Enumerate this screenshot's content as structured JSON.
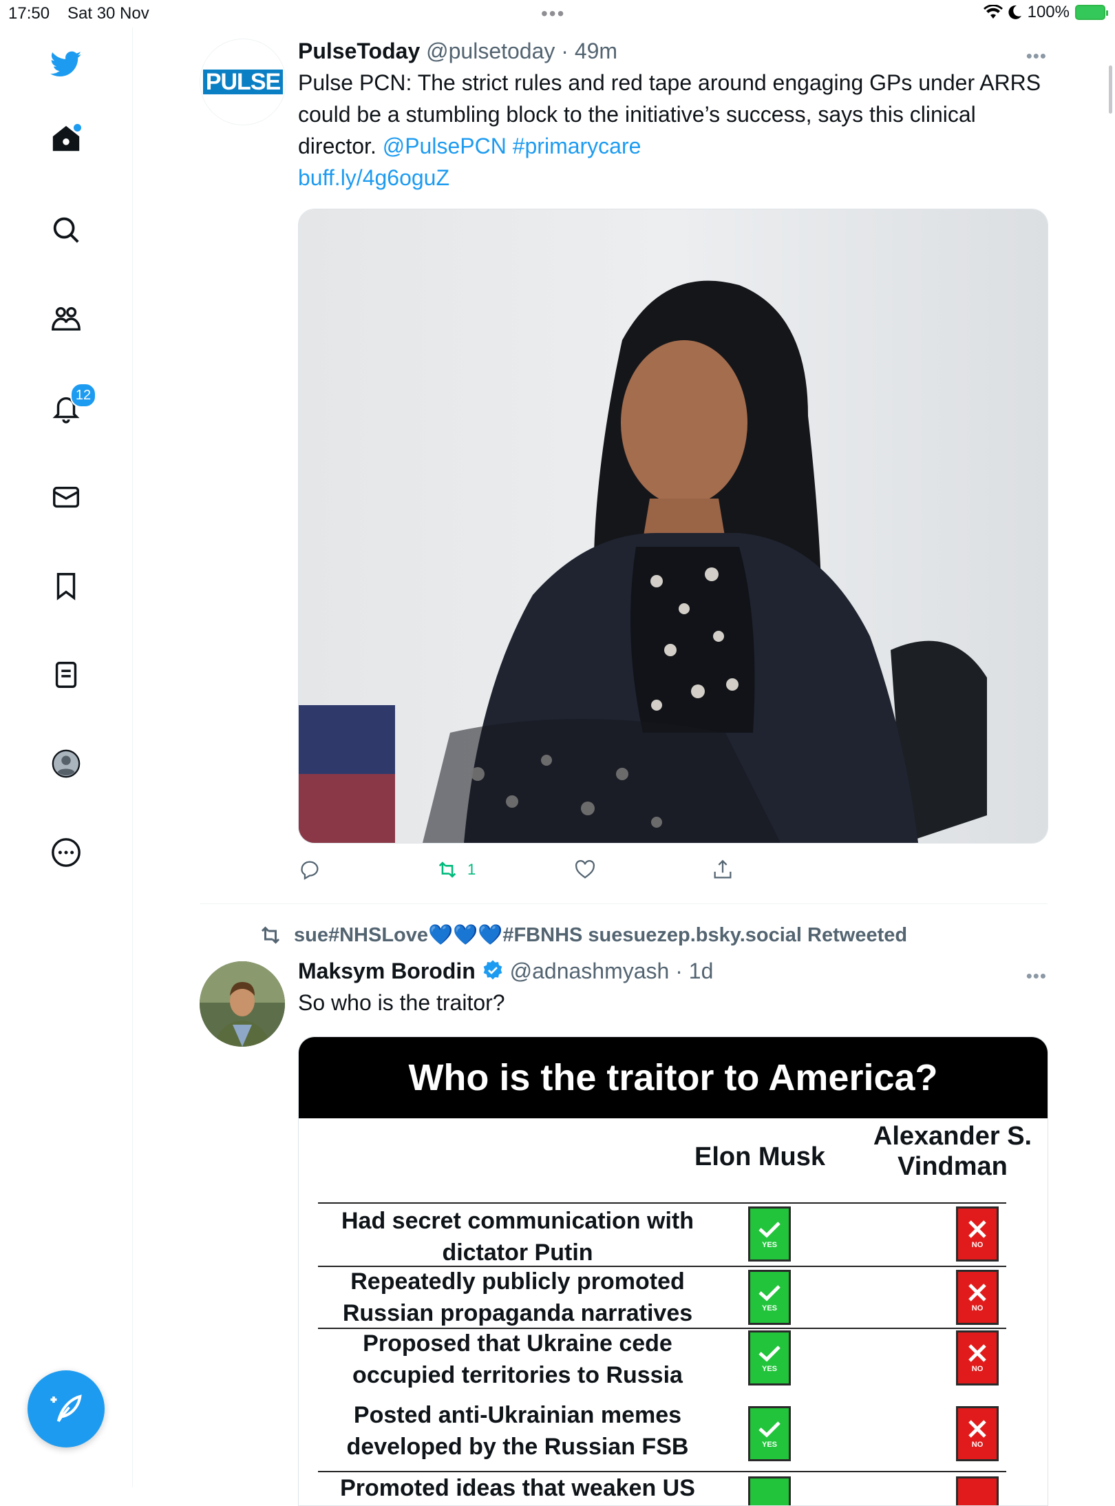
{
  "status_bar": {
    "time": "17:50",
    "date": "Sat 30 Nov",
    "battery": "100%"
  },
  "sidebar": {
    "notifications_badge": "12",
    "items": [
      "twitter-logo",
      "home",
      "search",
      "communities",
      "notifications",
      "messages",
      "bookmarks",
      "lists",
      "profile",
      "more"
    ]
  },
  "tweet1": {
    "name": "PulseToday",
    "handle": "@pulsetoday",
    "time": "49m",
    "avatar_text": "PULSE",
    "text": "Pulse PCN: The strict rules and red tape around engaging GPs under ARRS could be a stumbling block to the initiative’s success, says this clinical director.",
    "mention": "@PulsePCN",
    "hashtag": "#primarycare",
    "link": "buff.ly/4g6oguZ",
    "retweet_count": "1"
  },
  "retweet_banner": "sue#NHSLove💙💙💙#FBNHS suesuezep.bsky.social Retweeted",
  "tweet2": {
    "name": "Maksym Borodin",
    "handle": "@adnashmyash",
    "time": "1d",
    "text": "So who is the traitor?"
  },
  "infographic": {
    "title": "Who is the traitor to America?",
    "col1": "Elon Musk",
    "col2_line1": "Alexander S.",
    "col2_line2": "Vindman",
    "yes_label": "YES",
    "no_label": "NO",
    "rows": [
      {
        "l1": "Had secret communication with",
        "l2": "dictator Putin"
      },
      {
        "l1": "Repeatedly publicly promoted",
        "l2": "Russian propaganda narratives"
      },
      {
        "l1": "Proposed that Ukraine cede",
        "l2": "occupied territories to Russia"
      },
      {
        "l1": "Posted anti-Ukrainian memes",
        "l2": "developed by the Russian FSB"
      },
      {
        "l1": "Promoted ideas that weaken US",
        "l2": ""
      }
    ]
  },
  "colors": {
    "accent": "#1d9bf0",
    "retweet_green": "#00ba7c",
    "yes_green": "#21c43a",
    "no_red": "#e11b1b"
  }
}
